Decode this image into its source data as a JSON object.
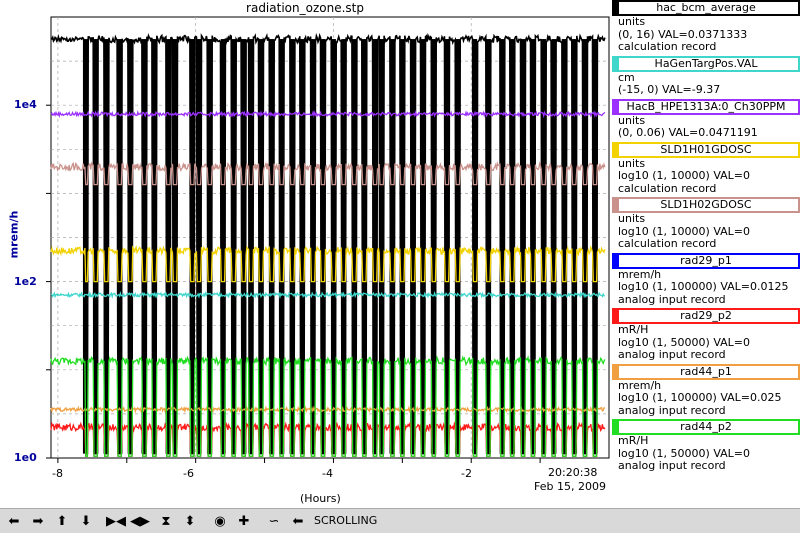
{
  "title": "radiation_ozone.stp",
  "y_axis": {
    "label": "mrem/h",
    "ticks": [
      "1e4",
      "1e2",
      "1e0"
    ]
  },
  "x_axis": {
    "label": "(Hours)",
    "ticks": [
      "-8",
      "-6",
      "-4",
      "-2"
    ]
  },
  "time": {
    "now": "20:20:38",
    "date": "Feb 15, 2009"
  },
  "legend": [
    {
      "name": "hac_bcm_average",
      "color": "#000000",
      "lines": [
        "units",
        "(0, 16) VAL=0.0371333",
        "calculation record"
      ]
    },
    {
      "name": "HaGenTargPos.VAL",
      "color": "#3fd6cc",
      "lines": [
        "cm",
        "(-15, 0) VAL=-9.37"
      ]
    },
    {
      "name": "HacB_HPE1313A:0_Ch30PPM",
      "color": "#9b30ff",
      "lines": [
        "units",
        "(0, 0.06) VAL=0.0471191"
      ]
    },
    {
      "name": "SLD1H01GDOSC",
      "color": "#f2d200",
      "lines": [
        "units",
        "log10 (1, 10000) VAL=0",
        "calculation record"
      ]
    },
    {
      "name": "SLD1H02GDOSC",
      "color": "#c9928c",
      "lines": [
        "units",
        "log10 (1, 10000) VAL=0",
        "calculation record"
      ]
    },
    {
      "name": "rad29_p1",
      "color": "#0000ff",
      "lines": [
        "mrem/h",
        "log10 (1, 100000) VAL=0.0125",
        "analog input record"
      ]
    },
    {
      "name": "rad29_p2",
      "color": "#ff1a1a",
      "lines": [
        "mR/H",
        "log10 (1, 50000) VAL=0",
        "analog input record"
      ]
    },
    {
      "name": "rad44_p1",
      "color": "#f0a040",
      "lines": [
        "mrem/h",
        "log10 (1, 100000) VAL=0.025",
        "analog input record"
      ]
    },
    {
      "name": "rad44_p2",
      "color": "#22dd22",
      "lines": [
        "mR/H",
        "log10 (1, 50000) VAL=0",
        "analog input record"
      ]
    }
  ],
  "toolbar": {
    "mode_label": "SCROLLING",
    "icons": [
      "arrow-left-icon",
      "arrow-right-icon",
      "arrow-up-icon",
      "arrow-down-icon",
      "zoom-in-horizontal-icon",
      "zoom-out-horizontal-icon",
      "zoom-in-vertical-icon",
      "zoom-out-vertical-icon",
      "record-icon",
      "add-icon",
      "autoscale-icon",
      "pin-icon"
    ]
  },
  "chart_data": {
    "type": "line",
    "title": "radiation_ozone.stp",
    "xlabel": "(Hours)",
    "ylabel": "mrem/h",
    "xlim": [
      -8.1,
      0
    ],
    "ylim_log10": [
      0,
      5
    ],
    "y_scale": "log",
    "grid": true,
    "series": [
      {
        "name": "hac_bcm_average",
        "color": "#000000",
        "level_log10": 4.75,
        "dips_to_log10": 0.05
      },
      {
        "name": "HaGenTargPos.VAL",
        "color": "#3fd6cc",
        "level_log10": 1.85
      },
      {
        "name": "HacB_HPE1313A:0_Ch30PPM",
        "color": "#9b30ff",
        "level_log10": 3.9
      },
      {
        "name": "SLD1H01GDOSC",
        "color": "#f2d200",
        "level_log10": 2.35,
        "dips_to_log10": 2.0
      },
      {
        "name": "SLD1H02GDOSC",
        "color": "#c9928c",
        "level_log10": 3.3,
        "dips_to_log10": 3.1
      },
      {
        "name": "rad29_p2",
        "color": "#ff1a1a",
        "level_log10": 0.35,
        "dips_to_log10": 0.02
      },
      {
        "name": "rad44_p1",
        "color": "#f0a040",
        "level_log10": 0.55
      },
      {
        "name": "rad44_p2",
        "color": "#22dd22",
        "level_log10": 1.1,
        "dips_to_log10": 0.02
      }
    ],
    "beam_trips_hours": [
      -7.6,
      -7.45,
      -7.3,
      -7.1,
      -6.95,
      -6.75,
      -6.6,
      -6.4,
      -6.3,
      -6.05,
      -5.95,
      -5.8,
      -5.6,
      -5.45,
      -5.3,
      -5.2,
      -5.05,
      -4.9,
      -4.75,
      -4.6,
      -4.45,
      -4.3,
      -4.15,
      -4.0,
      -3.85,
      -3.7,
      -3.55,
      -3.4,
      -3.3,
      -3.15,
      -3.0,
      -2.85,
      -2.7,
      -2.55,
      -2.35,
      -2.2,
      -1.95,
      -1.75,
      -1.55,
      -1.4,
      -1.25,
      -1.1,
      -0.95,
      -0.8,
      -0.65,
      -0.5,
      -0.35,
      -0.2
    ]
  }
}
